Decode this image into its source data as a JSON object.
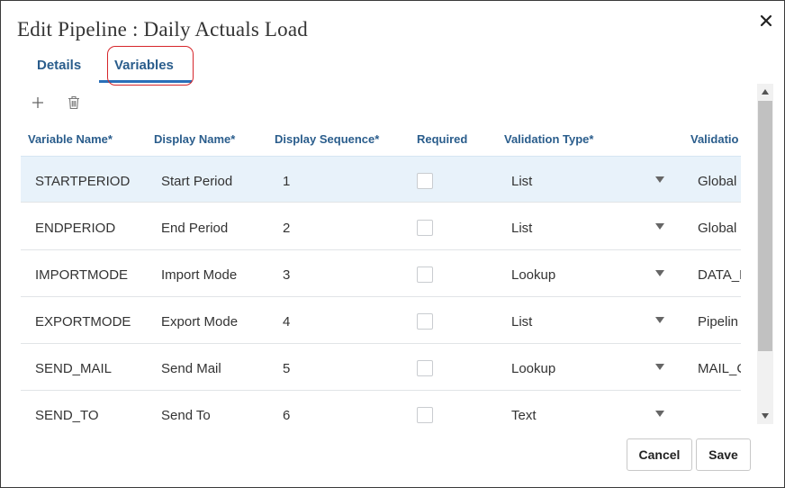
{
  "dialog": {
    "title": "Edit Pipeline : Daily Actuals Load"
  },
  "tabs": [
    {
      "label": "Details"
    },
    {
      "label": "Variables"
    }
  ],
  "grid": {
    "columns": [
      {
        "label": "Variable Name*"
      },
      {
        "label": "Display Name*"
      },
      {
        "label": "Display Sequence*"
      },
      {
        "label": "Required"
      },
      {
        "label": "Validation Type*"
      },
      {
        "label": "Validatio"
      }
    ],
    "rows": [
      {
        "variable_name": "STARTPERIOD",
        "display_name": "Start Period",
        "sequence": "1",
        "required": false,
        "validation_type": "List",
        "validation": "Global"
      },
      {
        "variable_name": "ENDPERIOD",
        "display_name": "End Period",
        "sequence": "2",
        "required": false,
        "validation_type": "List",
        "validation": "Global"
      },
      {
        "variable_name": "IMPORTMODE",
        "display_name": "Import Mode",
        "sequence": "3",
        "required": false,
        "validation_type": "Lookup",
        "validation": "DATA_L"
      },
      {
        "variable_name": "EXPORTMODE",
        "display_name": "Export Mode",
        "sequence": "4",
        "required": false,
        "validation_type": "List",
        "validation": "Pipelin"
      },
      {
        "variable_name": "SEND_MAIL",
        "display_name": "Send Mail",
        "sequence": "5",
        "required": false,
        "validation_type": "Lookup",
        "validation": "MAIL_C"
      },
      {
        "variable_name": "SEND_TO",
        "display_name": "Send To",
        "sequence": "6",
        "required": false,
        "validation_type": "Text",
        "validation": ""
      }
    ]
  },
  "footer": {
    "cancel_label": "Cancel",
    "save_label": "Save"
  },
  "icons": {
    "close": "close-icon",
    "add": "plus-icon",
    "delete": "trash-icon",
    "dropdown": "triangle-down-icon"
  },
  "colors": {
    "accent": "#2a5d8c",
    "tab_underline": "#2a6fb8",
    "highlight": "#d6262b",
    "selected_row": "#e8f2fa"
  }
}
